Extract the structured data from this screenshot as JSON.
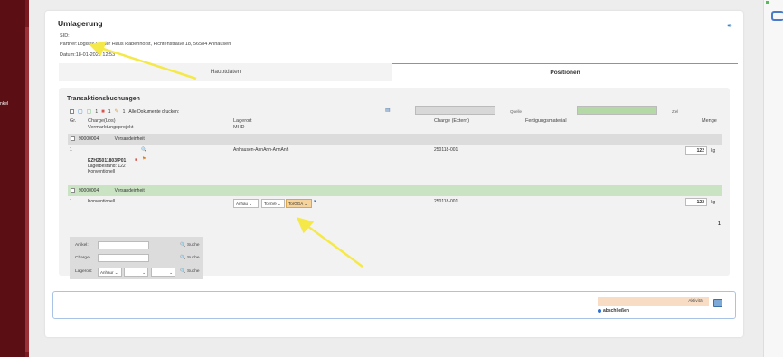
{
  "sidebar": {
    "label": "nkel"
  },
  "page": {
    "title": "Umlagerung",
    "sid_label": "SID:",
    "partner_text": "Partner:Logistik Center Haus Rabenhorst, Fichtenstraße 18, 56584 Anhausen",
    "datum_text": "Datum:18-01-2025 12:53"
  },
  "tabs": [
    {
      "label": "Hauptdaten"
    },
    {
      "label": "Positionen"
    }
  ],
  "transactions": {
    "title": "Transaktionsbuchungen",
    "toolbar": {
      "count1": "1",
      "count2": "1",
      "count3": "1",
      "print_label": "Alle Dokumente drucken:",
      "source_label": "Quelle",
      "target_label": "Ziel"
    },
    "headers": {
      "gr": "Gr.",
      "charge_los": "Charge(Los)",
      "vermarktungsprojekt": "Vermarktungsprojekt",
      "lagerort": "Lagerort",
      "mhd": "MHD",
      "charge_extern": "Charge (Extern)",
      "fertigungsmaterial": "Fertigungsmaterial",
      "menge": "Menge"
    },
    "group1": {
      "id": "90000004",
      "label": "Versandeinheit",
      "row": {
        "gr": "1",
        "lagerort": "Anhausen-AnnAnh-AnnAnh",
        "charge_extern": "250118-001",
        "qty": "122",
        "unit": "kg",
        "article": "EZH25011803\\P01",
        "stock": "Lagerbestand: 122",
        "project": "Konventionell"
      }
    },
    "group2": {
      "id": "90000004",
      "label": "Versandeinheit",
      "row": {
        "gr": "1",
        "project": "Konventionell",
        "sel1": "Anhau",
        "sel2": "TorsVe",
        "sel3": "TorGGA",
        "charge_extern": "250118-001",
        "qty": "122",
        "unit": "kg"
      }
    },
    "page_number": "1"
  },
  "filter": {
    "artikel_label": "Artikel:",
    "charge_label": "Charge:",
    "lagerort_label": "Lagerort:",
    "search_label": "Suche",
    "lagerort_value": "Anhaur"
  },
  "footer": {
    "aktivitaet_label": "Aktivität",
    "abschliessen_label": "abschließen"
  },
  "colors": {
    "sidebar": "#5b0f14",
    "tab_accent": "#e07a4a",
    "annotation_arrow": "#f5e94a",
    "group2_bg": "#c9e3c3",
    "target_box": "#b4d9a7"
  }
}
